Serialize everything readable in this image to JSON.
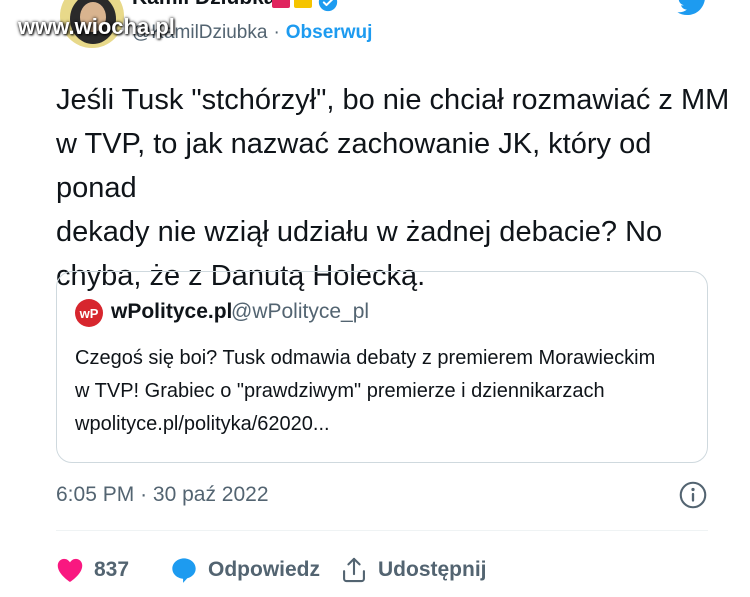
{
  "watermark": "www.wiocha.pl",
  "author": {
    "name": "Kamil Dziubka",
    "handle": "@KamilDziubka",
    "separator": "·",
    "follow_label": "Obserwuj"
  },
  "tweet": {
    "lines": [
      "Jeśli Tusk \"stchórzył\", bo nie chciał rozmawiać z MM",
      "w TVP, to jak nazwać zachowanie JK, który od ponad",
      "dekady nie wziął udziału w żadnej debacie? No",
      "chyba, że z Danutą Holecką."
    ]
  },
  "quote": {
    "avatar_text": "wP",
    "name": "wPolityce.pl",
    "handle": "@wPolityce_pl",
    "lines": [
      "Czegoś się boi? Tusk odmawia debaty z premierem Morawieckim",
      "w TVP! Grabiec o \"prawdziwym\" premierze i dziennikarzach",
      "wpolityce.pl/polityka/62020..."
    ]
  },
  "meta": {
    "time": "6:05 PM",
    "separator": "·",
    "date": "30 paź 2022"
  },
  "actions": {
    "likes": "837",
    "reply_label": "Odpowiedz",
    "share_label": "Udostępnij"
  },
  "colors": {
    "accent": "#1d9bf0",
    "like": "#f91880",
    "text": "#0f1419",
    "muted": "#536471",
    "border": "#cfd9de"
  },
  "icons": [
    "verified-badge-icon",
    "twitter-bird-icon",
    "info-icon",
    "heart-icon",
    "reply-bubble-icon",
    "share-icon"
  ]
}
